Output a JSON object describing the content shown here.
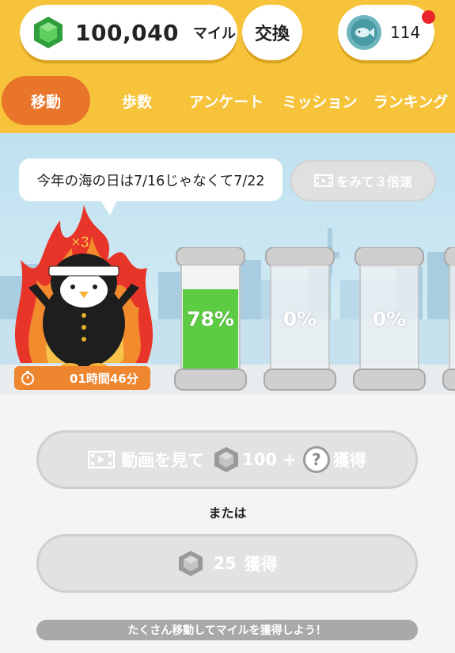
{
  "header": {
    "miles_value": "100,040",
    "miles_unit": "マイル",
    "exchange_label": "交換",
    "fish_count": "114",
    "gem_color": "#3fb24a",
    "notification_color": "#e8262a"
  },
  "tabs": [
    {
      "label": "移動",
      "active": true
    },
    {
      "label": "歩数",
      "active": false
    },
    {
      "label": "アンケート",
      "active": false
    },
    {
      "label": "ミッション",
      "active": false
    },
    {
      "label": "ランキング",
      "active": false
    }
  ],
  "scene": {
    "speech_text": "今年の海の日は7/16じゃなくて7/22",
    "watch_button_label": "をみて３倍速",
    "multiplier_badge": "×3",
    "timer_text": "01時間46分",
    "jars": [
      {
        "label": "78%",
        "fill": 0.78
      },
      {
        "label": "0%",
        "fill": 0
      },
      {
        "label": "0%",
        "fill": 0
      }
    ]
  },
  "actions": {
    "video_prefix": "動画を見て",
    "video_amount": "100 +",
    "video_suffix": "獲得",
    "mystery_symbol": "?",
    "or_text": "または",
    "earn_amount": "25",
    "earn_suffix": "獲得",
    "footer_text": "たくさん移動してマイルを獲得しよう！"
  }
}
